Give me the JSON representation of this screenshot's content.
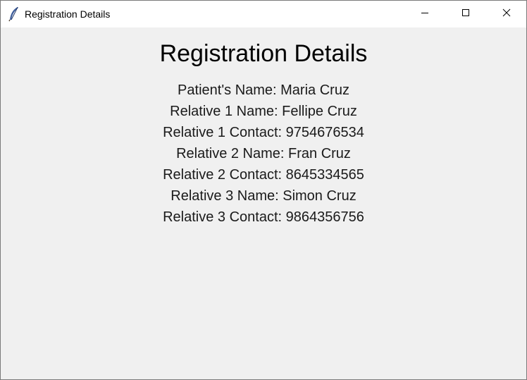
{
  "window": {
    "title": "Registration Details",
    "app_icon": "feather-icon",
    "controls": {
      "minimize_icon": "minimize-icon",
      "maximize_icon": "maximize-icon",
      "close_icon": "close-icon"
    }
  },
  "main": {
    "heading": "Registration Details",
    "lines": [
      "Patient's Name: Maria Cruz",
      "Relative 1 Name: Fellipe Cruz",
      "Relative 1 Contact: 9754676534",
      "Relative 2 Name: Fran Cruz",
      "Relative 2 Contact: 8645334565",
      "Relative 3 Name: Simon Cruz",
      "Relative 3 Contact: 9864356756"
    ]
  },
  "colors": {
    "background": "#f0f0f0",
    "titlebar": "#ffffff",
    "text": "#000000"
  }
}
